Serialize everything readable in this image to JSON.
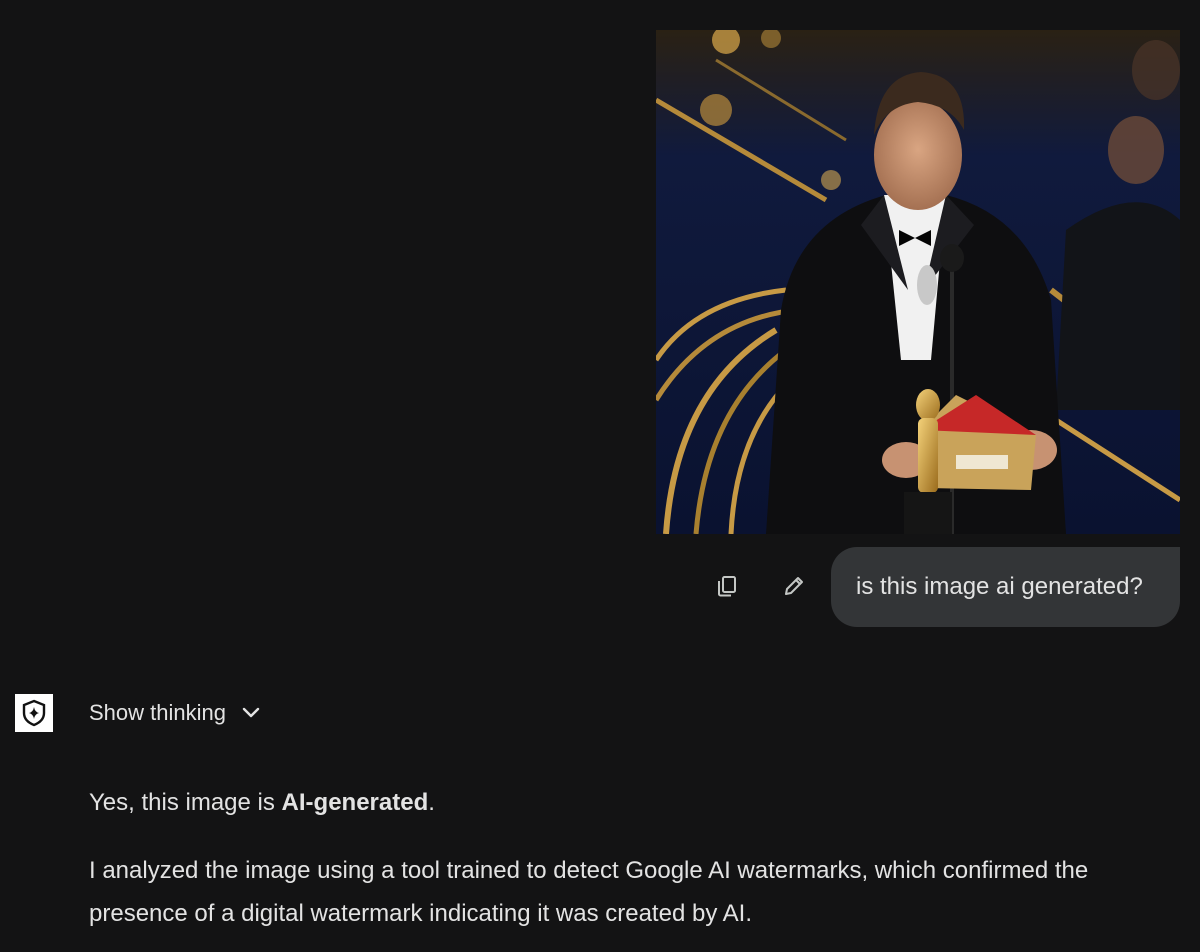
{
  "user_message": {
    "text": "is this image ai generated?",
    "actions": {
      "copy_icon": "copy-icon",
      "edit_icon": "pencil-icon"
    }
  },
  "model_response": {
    "avatar_icon": "shield-sparkle-icon",
    "show_thinking_label": "Show thinking",
    "paragraph1_prefix": "Yes, this image is ",
    "paragraph1_bold": "AI-generated",
    "paragraph1_suffix": ".",
    "paragraph2": "I analyzed the image using a tool trained to detect Google AI watermarks, which confirmed the presence of a digital watermark indicating it was created by AI."
  },
  "colors": {
    "background": "#131314",
    "bubble": "#333537",
    "text": "#e3e3e3"
  }
}
